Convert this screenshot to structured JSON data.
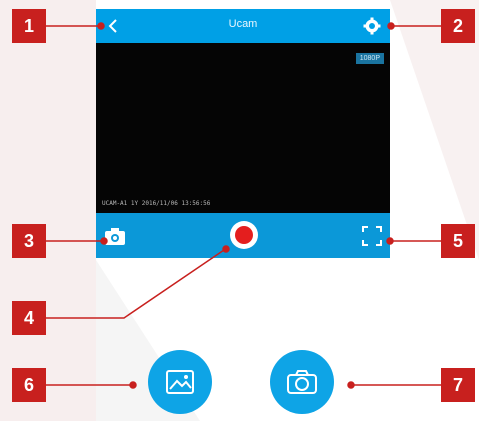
{
  "app": {
    "title": "Ucam"
  },
  "video": {
    "resolution_badge": "1080P",
    "osd_text": "UCAM-A1  1Y  2016/11/06  13:56:56"
  },
  "icons": {
    "back": "back-chevron-icon",
    "settings": "gear-icon",
    "snapshot": "camera-icon",
    "record": "record-icon",
    "fullscreen": "fullscreen-icon",
    "gallery": "image-gallery-icon",
    "capture": "camera-capture-icon"
  },
  "callouts": [
    "1",
    "2",
    "3",
    "4",
    "5",
    "6",
    "7"
  ],
  "colors": {
    "accent": "#00a0e6",
    "callout": "#c8201e",
    "record": "#e41e1e",
    "video_bg": "#050505"
  }
}
